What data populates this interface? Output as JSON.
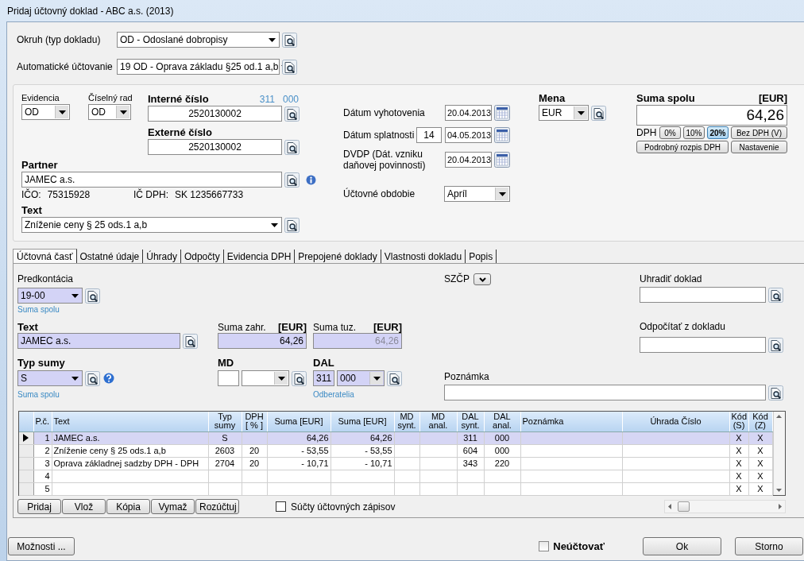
{
  "window": {
    "title": "Pridaj účtovný doklad - ABC a.s. (2013)"
  },
  "header": [
    {
      "label": "Okruh (typ dokladu)",
      "value": "OD - Odoslané dobropisy"
    },
    {
      "label": "Automatické účtovanie",
      "value": "19 OD - Oprava základu §25 od.1 a,b"
    }
  ],
  "document": {
    "evidencia": {
      "label": "Evidencia",
      "value": "OD"
    },
    "ciselny_rad": {
      "label": "Číselný rad",
      "value": "OD"
    },
    "interne_cislo": {
      "label": "Interné číslo",
      "value": "2520130002",
      "account_synt": "311",
      "account_anal": "000"
    },
    "externe_cislo": {
      "label": "Externé číslo",
      "value": "2520130002"
    },
    "partner": {
      "label": "Partner",
      "value": "JAMEC a.s.",
      "ico_label": "IČO:",
      "ico": "75315928",
      "ic_dph_label": "IČ DPH:",
      "ic_dph": "SK 1235667733"
    },
    "text": {
      "label": "Text",
      "value": "Zníženie ceny § 25 ods.1 a,b"
    },
    "dates": [
      {
        "label": "Dátum vyhotovenia",
        "value": "20.04.2013"
      },
      {
        "label": "Dátum splatnosti",
        "days": "14",
        "value": "04.05.2013"
      },
      {
        "label": "DVDP (Dát. vzniku daňovej povinnosti)",
        "value": "20.04.2013"
      }
    ],
    "period": {
      "label": "Účtovné obdobie",
      "value": "Apríl"
    },
    "currency": {
      "label": "Mena",
      "value": "EUR"
    },
    "total": {
      "label": "Suma spolu",
      "unit": "[EUR]",
      "value": "64,26",
      "vat_label": "DPH",
      "vat_rates": [
        {
          "label": "0%",
          "selected": false
        },
        {
          "label": "10%",
          "selected": false
        },
        {
          "label": "20%",
          "selected": true
        }
      ],
      "buttons": [
        "Bez DPH (V)",
        "Podrobný rozpis DPH",
        "Nastavenie"
      ]
    }
  },
  "tabs": [
    {
      "label": "Účtovná časť",
      "selected": true
    },
    {
      "label": "Ostatné údaje",
      "selected": false
    },
    {
      "label": "Úhrady",
      "selected": false
    },
    {
      "label": "Odpočty",
      "selected": false
    },
    {
      "label": "Evidencia DPH",
      "selected": false
    },
    {
      "label": "Prepojené doklady",
      "selected": false
    },
    {
      "label": "Vlastnosti dokladu",
      "selected": false
    },
    {
      "label": "Popis",
      "selected": false
    }
  ],
  "tab_content": {
    "predkontacia": {
      "label": "Predkontácia",
      "value": "19-00",
      "hint": "Suma spolu",
      "highlighted": true
    },
    "szcp": {
      "label": "SZČP"
    },
    "uhradit_doklad": {
      "label": "Uhradiť doklad"
    },
    "text": {
      "label": "Text",
      "value": "JAMEC a.s.",
      "highlighted": true
    },
    "suma_zahr": {
      "label": "Suma zahr.",
      "unit": "[EUR]",
      "value": "64,26",
      "highlighted": true,
      "disabled": false
    },
    "suma_tuz": {
      "label": "Suma tuz.",
      "unit": "[EUR]",
      "value": "64,26",
      "highlighted": true,
      "disabled": true
    },
    "odpocitat": {
      "label": "Odpočítať z dokladu"
    },
    "typ_sumy": {
      "label": "Typ sumy",
      "value": "S",
      "hint": "Suma spolu",
      "highlighted": true
    },
    "md": {
      "label": "MD",
      "highlighted": false
    },
    "dal": {
      "label": "DAL",
      "synt": "311",
      "anal": "000",
      "hint": "Odberatelia",
      "highlighted": true
    },
    "poznamka": {
      "label": "Poznámka"
    }
  },
  "table": {
    "columns": [
      "P.č.",
      "Text",
      "Typ sumy",
      "DPH [ % ]",
      "Suma [EUR]",
      "Suma [EUR]",
      "MD synt.",
      "MD anal.",
      "DAL synt.",
      "DAL anal.",
      "Poznámka",
      "Úhrada Číslo",
      "Kód (S)",
      "Kód (Z)"
    ],
    "rows": [
      {
        "selected": true,
        "cells": [
          "1",
          "JAMEC a.s.",
          "S",
          null,
          "64,26",
          "64,26",
          null,
          null,
          "311",
          "000",
          null,
          null,
          "X",
          "X"
        ]
      },
      {
        "selected": false,
        "cells": [
          "2",
          "Zníženie ceny § 25 ods.1 a,b",
          "2603",
          "20",
          "- 53,55",
          "- 53,55",
          null,
          null,
          "604",
          "000",
          null,
          null,
          "X",
          "X"
        ]
      },
      {
        "selected": false,
        "cells": [
          "3",
          "Oprava základnej sadzby DPH - DPH",
          "2704",
          "20",
          "- 10,71",
          "- 10,71",
          null,
          null,
          "343",
          "220",
          null,
          null,
          "X",
          "X"
        ]
      },
      {
        "selected": false,
        "cells": [
          "4",
          null,
          null,
          null,
          null,
          null,
          null,
          null,
          null,
          null,
          null,
          null,
          "X",
          "X"
        ]
      },
      {
        "selected": false,
        "cells": [
          "5",
          null,
          null,
          null,
          null,
          null,
          null,
          null,
          null,
          null,
          null,
          null,
          "X",
          "X"
        ]
      }
    ]
  },
  "table_buttons": [
    "Pridaj",
    "Vlož",
    "Kópia",
    "Vymaž",
    "Rozúčtuj"
  ],
  "sums_checkbox": {
    "label": "Súčty účtovných zápisov",
    "checked": false
  },
  "footer": {
    "options_button": "Možnosti ...",
    "no_post": {
      "label": "Neúčtovať",
      "checked": false
    },
    "buttons": [
      "Ok",
      "Storno"
    ]
  }
}
